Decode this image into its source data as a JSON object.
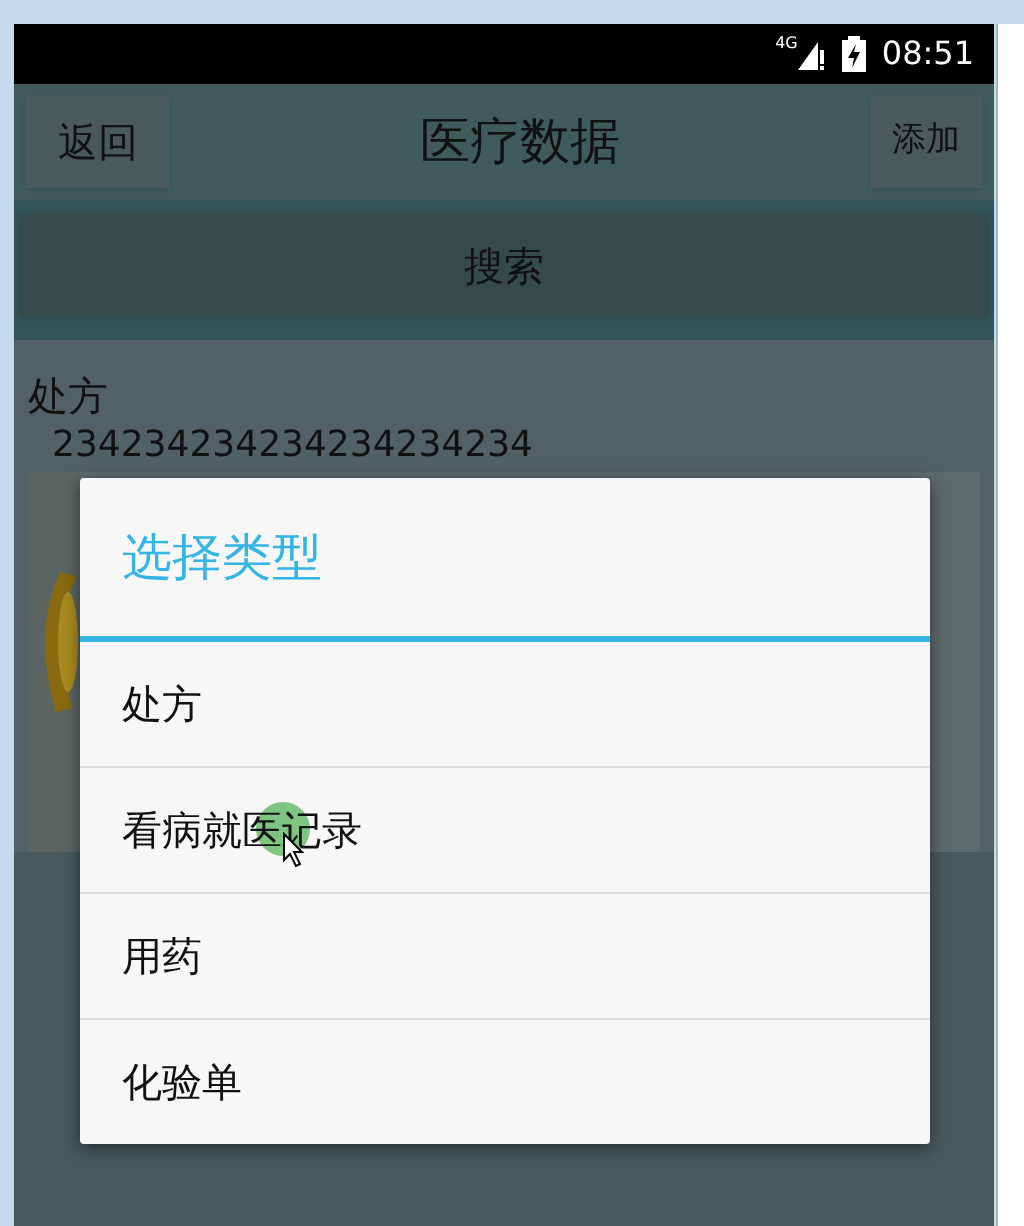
{
  "status_bar": {
    "network": "4G",
    "time": "08:51"
  },
  "app_bar": {
    "back_button": "返回",
    "title": "医疗数据",
    "add_button": "添加"
  },
  "search_button": "搜索",
  "record": {
    "type": "处方",
    "number": "234234234234234234234"
  },
  "dialog": {
    "title": "选择类型",
    "items": [
      {
        "label": "处方",
        "pressed": false
      },
      {
        "label": "看病就医记录",
        "pressed": true
      },
      {
        "label": "用药",
        "pressed": false
      },
      {
        "label": "化验单",
        "pressed": false
      }
    ]
  }
}
